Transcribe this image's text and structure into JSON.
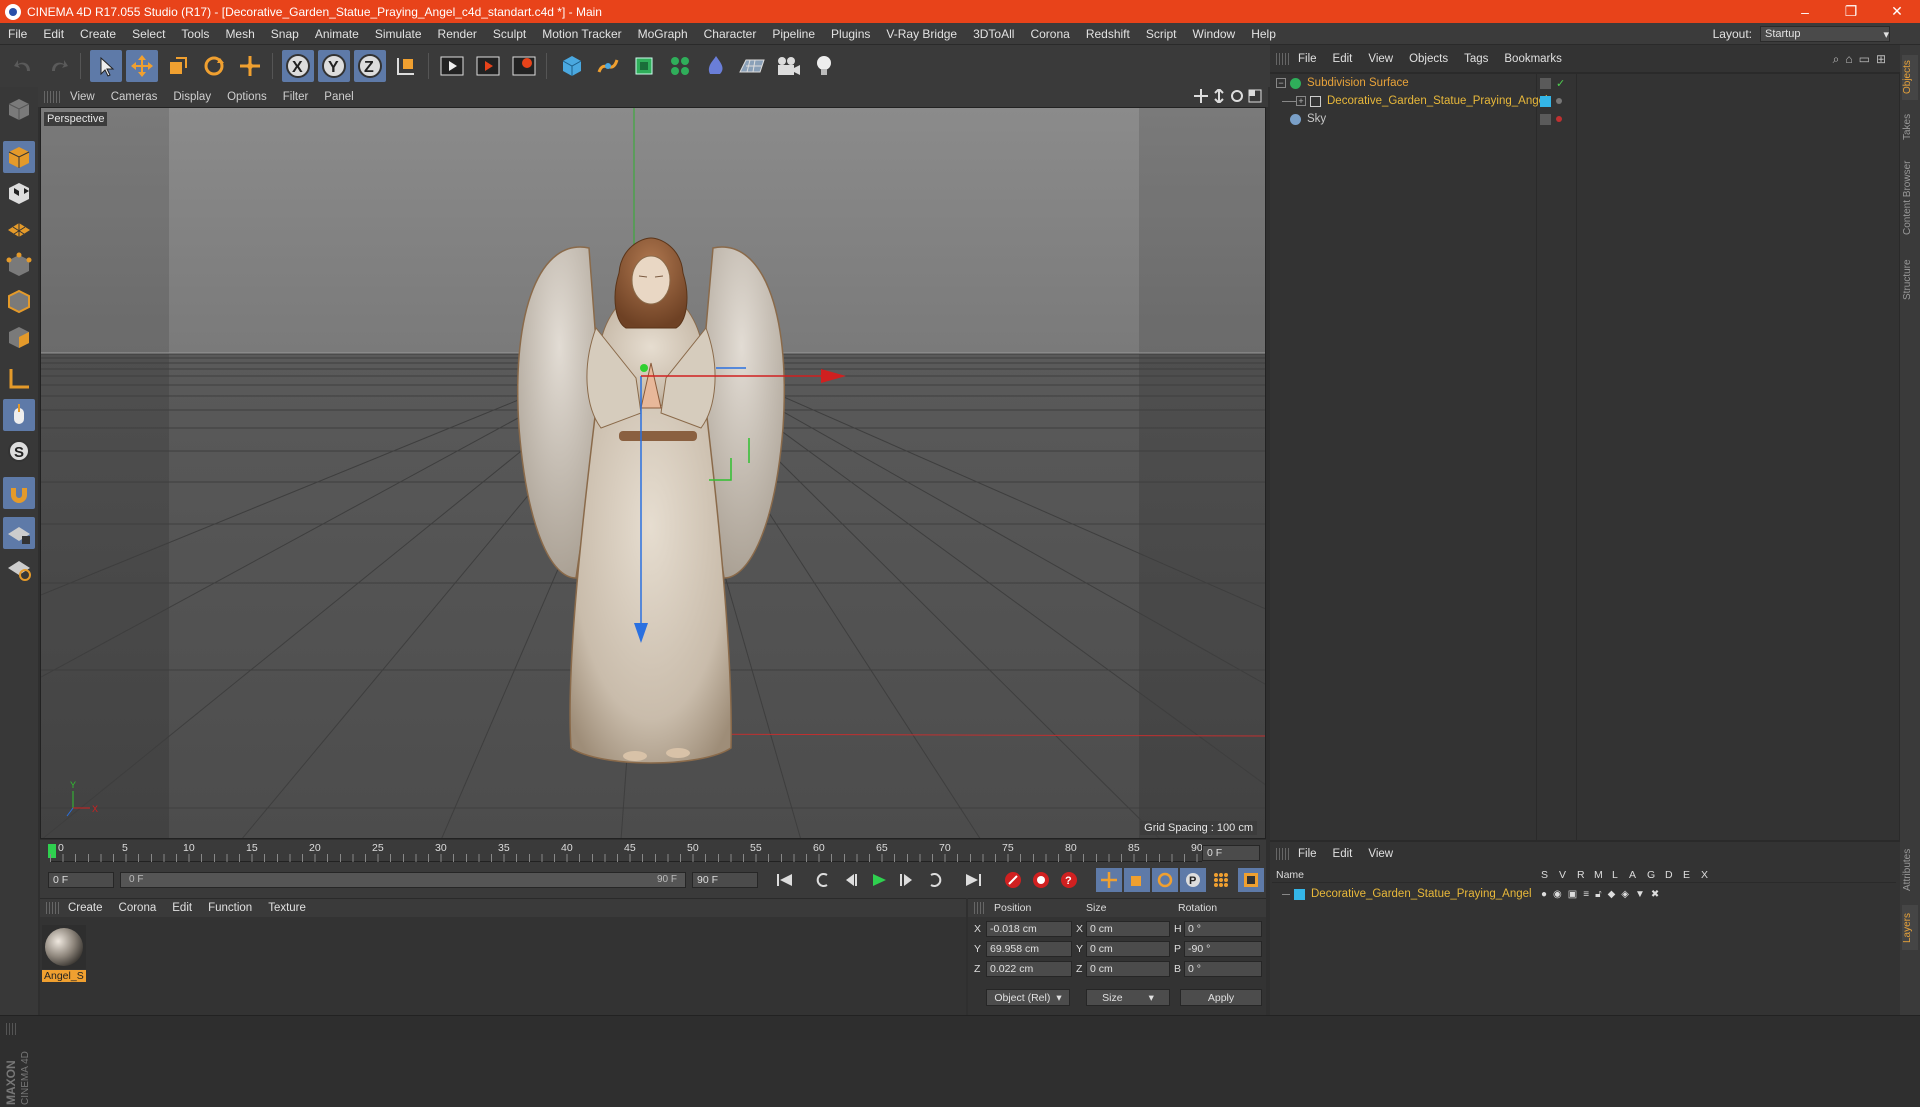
{
  "app": {
    "title": "CINEMA 4D R17.055 Studio (R17) - [Decorative_Garden_Statue_Praying_Angel_c4d_standart.c4d *] - Main",
    "window_buttons": [
      "–",
      "❐",
      "✕"
    ]
  },
  "menu": [
    "File",
    "Edit",
    "Create",
    "Select",
    "Tools",
    "Mesh",
    "Snap",
    "Animate",
    "Simulate",
    "Render",
    "Sculpt",
    "Motion Tracker",
    "MoGraph",
    "Character",
    "Pipeline",
    "Plugins",
    "V-Ray Bridge",
    "3DToAll",
    "Corona",
    "Redshift",
    "Script",
    "Window",
    "Help"
  ],
  "layout": {
    "label": "Layout:",
    "value": "Startup"
  },
  "viewport": {
    "menu": [
      "View",
      "Cameras",
      "Display",
      "Options",
      "Filter",
      "Panel"
    ],
    "label": "Perspective",
    "grid_spacing": "Grid Spacing : 100 cm",
    "axis_y": "Y",
    "axis_x": "X"
  },
  "objects_panel": {
    "menu": [
      "File",
      "Edit",
      "View",
      "Objects",
      "Tags",
      "Bookmarks"
    ],
    "items": [
      {
        "name": "Subdivision Surface",
        "color": "#e8a33a"
      },
      {
        "name": "Decorative_Garden_Statue_Praying_Angel",
        "color": "#e8b83a"
      },
      {
        "name": "Sky",
        "color": "#c8c8c8"
      }
    ]
  },
  "side_tabs": [
    "Objects",
    "Takes",
    "Content Browser",
    "Structure"
  ],
  "side_tabs_lower": [
    "Attributes",
    "Layers"
  ],
  "layers_panel": {
    "menu": [
      "File",
      "Edit",
      "View"
    ],
    "columns": [
      "Name",
      "S",
      "V",
      "R",
      "M",
      "L",
      "A",
      "G",
      "D",
      "E",
      "X"
    ],
    "row": "Decorative_Garden_Statue_Praying_Angel"
  },
  "timeline": {
    "ticks": [
      "0",
      "5",
      "10",
      "15",
      "20",
      "25",
      "30",
      "35",
      "40",
      "45",
      "50",
      "55",
      "60",
      "65",
      "70",
      "75",
      "80",
      "85",
      "90"
    ],
    "end_frame": "0 F",
    "start_field": "0 F",
    "range_start": "0 F",
    "range_end": "90 F",
    "max_field": "90 F"
  },
  "material_panel": {
    "menu": [
      "Create",
      "Corona",
      "Edit",
      "Function",
      "Texture"
    ],
    "material_name": "Angel_S"
  },
  "coordinates": {
    "headers": [
      "Position",
      "Size",
      "Rotation"
    ],
    "rows": [
      {
        "axis": "X",
        "pos": "-0.018 cm",
        "size_axis": "X",
        "size": "0 cm",
        "rot_axis": "H",
        "rot": "0 °"
      },
      {
        "axis": "Y",
        "pos": "69.958 cm",
        "size_axis": "Y",
        "size": "0 cm",
        "rot_axis": "P",
        "rot": "-90 °"
      },
      {
        "axis": "Z",
        "pos": "0.022 cm",
        "size_axis": "Z",
        "size": "0 cm",
        "rot_axis": "B",
        "rot": "0 °"
      }
    ],
    "mode": "Object (Rel)",
    "size_mode": "Size",
    "apply": "Apply"
  },
  "brand": {
    "maxon": "MAXON",
    "c4d": "CINEMA 4D"
  }
}
